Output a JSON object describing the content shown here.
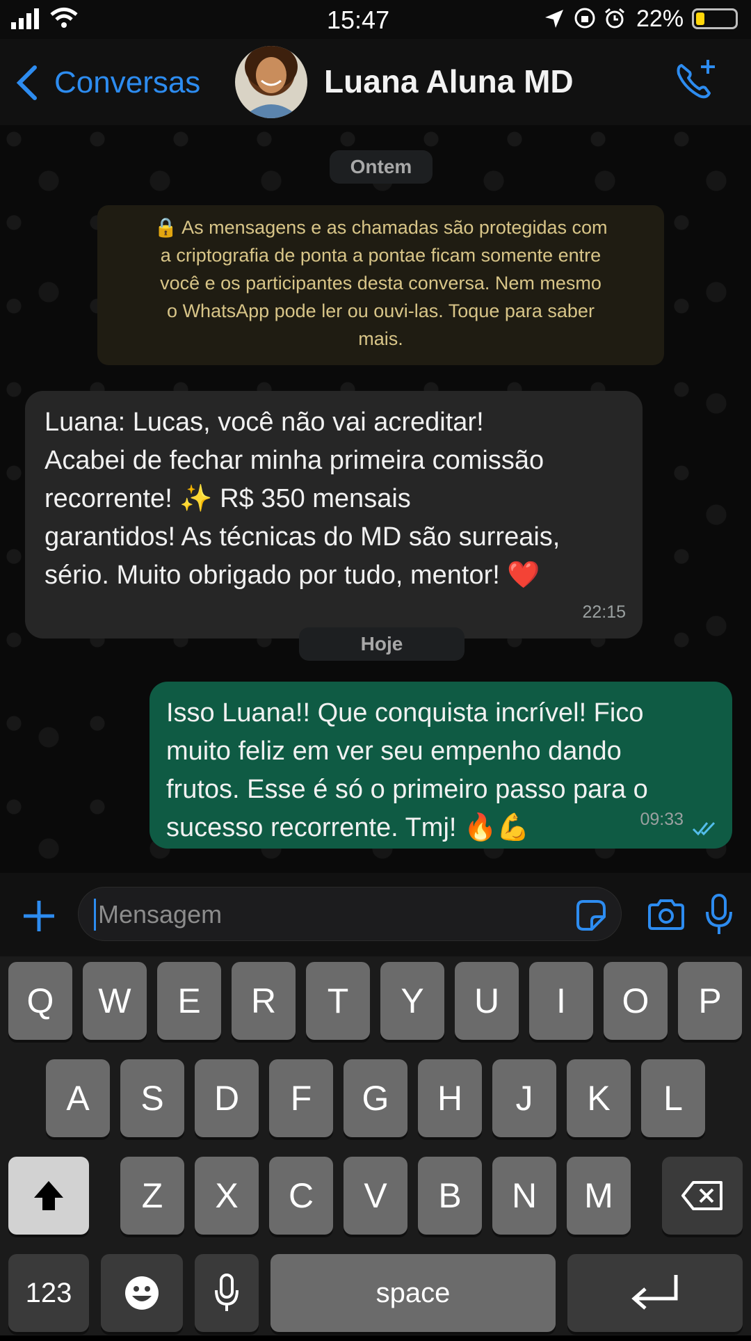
{
  "status_bar": {
    "time": "15:47",
    "battery_percent": "22%",
    "battery_level": 0.22
  },
  "header": {
    "back_label": "Conversas",
    "contact_name": "Luana Aluna MD",
    "call_icon": "phone-plus-icon",
    "accent_color": "#2d8cf0"
  },
  "chat": {
    "date_yesterday": "Ontem",
    "encryption_lines": [
      "🔒 As mensagens e as chamadas são protegidas com",
      "a criptografia de ponta a pontae ficam somente entre",
      "você e os participantes desta conversa. Nem mesmo",
      "o WhatsApp pode ler ou ouvi-las. Toque para saber",
      "mais."
    ],
    "incoming_message": {
      "lines": [
        "Luana: Lucas, você não vai acreditar!",
        "Acabei de fechar minha primeira comissão",
        "recorrente! ✨ R$ 350 mensais",
        "garantidos! As técnicas do MD são surreais,",
        "sério. Muito obrigado por tudo, mentor! ❤️"
      ],
      "time": "22:15"
    },
    "date_today": "Hoje",
    "outgoing_message": {
      "lines": [
        "Isso Luana!! Que conquista incrível! Fico",
        "muito feliz em ver seu empenho dando",
        "frutos. Esse é só o primeiro passo para o",
        "sucesso recorrente. Tmj! 🔥💪"
      ],
      "time": "09:33",
      "read_status": "double-check-icon",
      "bubble_color": "#0f5b44"
    }
  },
  "composer": {
    "placeholder": "Mensagem",
    "plus_icon": "plus-icon",
    "sticker_icon": "sticker-icon",
    "camera_icon": "camera-icon",
    "mic_icon": "microphone-icon"
  },
  "keyboard": {
    "row1": [
      "Q",
      "W",
      "E",
      "R",
      "T",
      "Y",
      "U",
      "I",
      "O",
      "P"
    ],
    "row2": [
      "A",
      "S",
      "D",
      "F",
      "G",
      "H",
      "J",
      "K",
      "L"
    ],
    "row3": [
      "Z",
      "X",
      "C",
      "V",
      "B",
      "N",
      "M"
    ],
    "numbers_label": "123",
    "space_label": "space"
  }
}
